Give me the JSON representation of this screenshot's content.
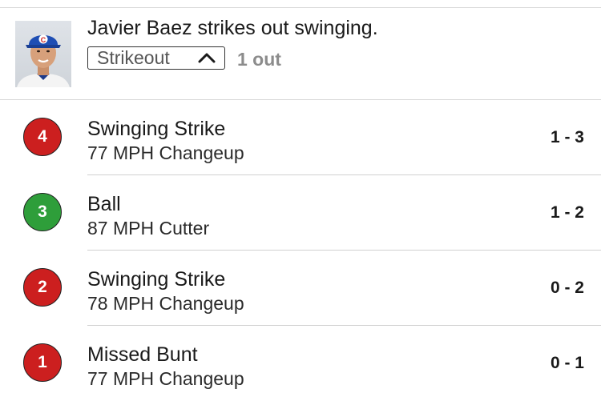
{
  "play": {
    "description": "Javier Baez strikes out swinging.",
    "result_label": "Strikeout",
    "result_chevron_icon": "chevron-up-icon",
    "outs_text": "1 out",
    "batter_avatar": "player-headshot"
  },
  "colors": {
    "strike": "#cc1f1f",
    "ball": "#2e9e3a",
    "muted_text": "#8c8c8c",
    "divider": "#d9d9d9"
  },
  "pitches": [
    {
      "number": "4",
      "type": "strike",
      "result": "Swinging Strike",
      "detail": "77 MPH Changeup",
      "count": "1 - 3"
    },
    {
      "number": "3",
      "type": "ball",
      "result": "Ball",
      "detail": "87 MPH Cutter",
      "count": "1 - 2"
    },
    {
      "number": "2",
      "type": "strike",
      "result": "Swinging Strike",
      "detail": "78 MPH Changeup",
      "count": "0 - 2"
    },
    {
      "number": "1",
      "type": "strike",
      "result": "Missed Bunt",
      "detail": "77 MPH Changeup",
      "count": "0 - 1"
    }
  ]
}
